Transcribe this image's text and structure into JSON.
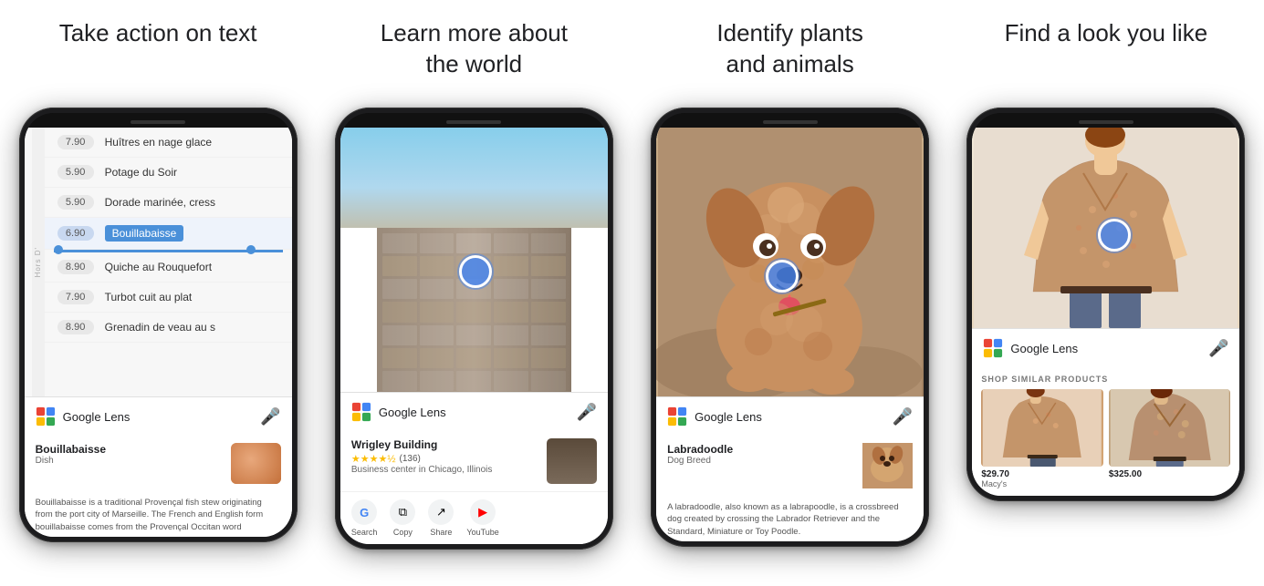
{
  "columns": [
    {
      "id": "col1",
      "title": "Take action on text",
      "phone": {
        "menu_items": [
          {
            "price": "7.90",
            "text": "Huîtres en nage glace"
          },
          {
            "price": "5.90",
            "text": "Potage du Soir"
          },
          {
            "price": "5.90",
            "text": "Dorade marinée, cress"
          },
          {
            "price": "6.90",
            "text": "Bouillabaisse",
            "selected": true
          },
          {
            "price": "8.90",
            "text": "Quiche au Rouquefort"
          },
          {
            "price": "7.90",
            "text": "Turbot cuit au plat"
          },
          {
            "price": "8.90",
            "text": "Grenadin de veau au s"
          }
        ],
        "side_label": "Hors D'",
        "lens_title": "Google Lens",
        "result_name": "Bouillabaisse",
        "result_type": "Dish",
        "result_desc": "Bouillabaisse is a traditional Provençal fish stew originating from the port city of Marseille. The French and English form bouillabaisse comes from the Provençal Occitan word"
      }
    },
    {
      "id": "col2",
      "title": "Learn more about\nthe world",
      "phone": {
        "lens_title": "Google Lens",
        "result_name": "Wrigley Building",
        "result_subtype": "Business center in Chicago, Illinois",
        "result_stars": "4.5",
        "result_reviews": "(136)",
        "actions": [
          "Search",
          "Copy",
          "Share",
          "YouTube"
        ]
      }
    },
    {
      "id": "col3",
      "title": "Identify plants\nand animals",
      "phone": {
        "lens_title": "Google Lens",
        "result_name": "Labradoodle",
        "result_type": "Dog Breed",
        "result_desc": "A labradoodle, also known as a labrapoodle, is a crossbreed dog created by crossing the Labrador Retriever and the Standard, Miniature or Toy Poodle."
      }
    },
    {
      "id": "col4",
      "title": "Find a look you like",
      "phone": {
        "lens_title": "Google Lens",
        "shop_section_title": "SHOP SIMILAR PRODUCTS",
        "items": [
          {
            "price": "$29.70",
            "store": "Macy's"
          },
          {
            "price": "$325.00",
            "store": ""
          }
        ]
      }
    }
  ],
  "icons": {
    "mic": "🎤",
    "search": "G",
    "copy": "⧉",
    "share": "↗",
    "youtube": "▶"
  }
}
